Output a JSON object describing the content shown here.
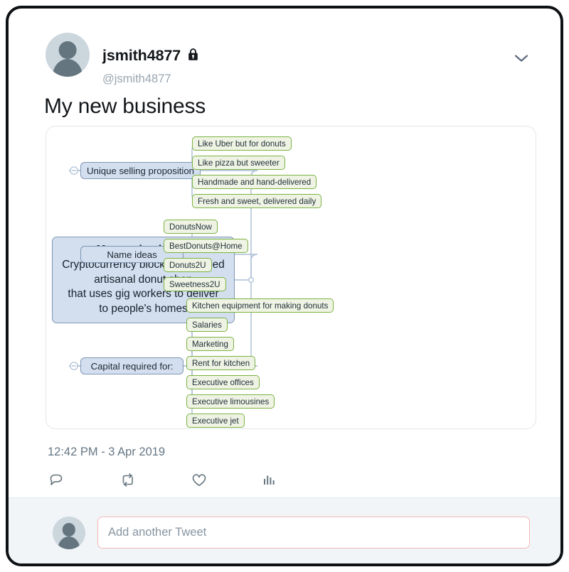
{
  "tweet": {
    "display_name": "jsmith4877",
    "handle": "@jsmith4877",
    "protected_icon": "lock-icon",
    "more_icon": "chevron-down-icon",
    "title": "My new business",
    "timestamp": "12:42 PM - 3 Apr 2019",
    "actions": [
      {
        "name": "reply",
        "icon": "reply-icon"
      },
      {
        "name": "retweet",
        "icon": "retweet-icon"
      },
      {
        "name": "like",
        "icon": "heart-icon"
      },
      {
        "name": "analytics",
        "icon": "analytics-icon"
      }
    ]
  },
  "compose": {
    "placeholder": "Add another Tweet",
    "value": "",
    "avatar_icon": "user-avatar-icon"
  },
  "mindmap": {
    "root": {
      "title": "My new business:",
      "lines": [
        "Cryptocurrency blockchain-based",
        "artisanal donut shop",
        "that uses gig workers to deliver",
        "to people's homes"
      ]
    },
    "branches": [
      {
        "label": "Unique selling proposition",
        "leaves": [
          "Like Uber but for donuts",
          "Like pizza but sweeter",
          "Handmade and hand-delivered",
          "Fresh and sweet, delivered daily"
        ]
      },
      {
        "label": "Name ideas",
        "leaves": [
          "DonutsNow",
          "BestDonuts@Home",
          "Donuts2U",
          "Sweetness2U"
        ]
      },
      {
        "label": "Capital required for:",
        "leaves": [
          "Kitchen equipment for making donuts",
          "Salaries",
          "Marketing",
          "Rent for kitchen",
          "Executive offices",
          "Executive limousines",
          "Executive jet"
        ]
      }
    ],
    "colors": {
      "root_fill": "#d3dfef",
      "root_stroke": "#7f96b4",
      "leaf_fill": "#eef3e4",
      "leaf_stroke": "#7cb342",
      "connector": "#a9bdd6"
    }
  }
}
